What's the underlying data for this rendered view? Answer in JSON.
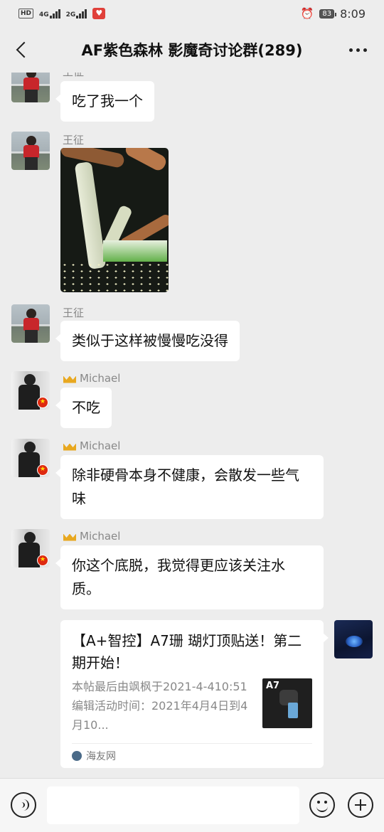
{
  "status_bar": {
    "left_badge": "HD",
    "net1": "4G",
    "net2": "2G",
    "battery": "83",
    "time": "8:09"
  },
  "header": {
    "title": "AF紫色森林 影魔奇讨论群(289)"
  },
  "messages": [
    {
      "sender": "王征",
      "text": "吃了我一个"
    },
    {
      "sender": "王征",
      "type": "image"
    },
    {
      "sender": "王征",
      "text": "类似于这样被慢慢吃没得"
    },
    {
      "sender": "Michael",
      "text": "不吃"
    },
    {
      "sender": "Michael",
      "text": "除非硬骨本身不健康，会散发一些气味"
    },
    {
      "sender": "Michael",
      "text": "你这个底脱，我觉得更应该关注水质。"
    }
  ],
  "shared_post": {
    "title": "【A+智控】A7珊 瑚灯顶贴送！第二期开始！",
    "description": "本帖最后由飒枫于2021-4-410:51编辑活动时间：2021年4月4日到4月10...",
    "thumb_text": "A7",
    "source": "海友网"
  },
  "input_bar": {
    "placeholder": ""
  },
  "icons": {
    "back": "back-arrow-icon",
    "more": "more-icon",
    "voice": "voice-icon",
    "emoji": "emoji-icon",
    "add": "plus-icon",
    "crown": "crown-icon"
  }
}
